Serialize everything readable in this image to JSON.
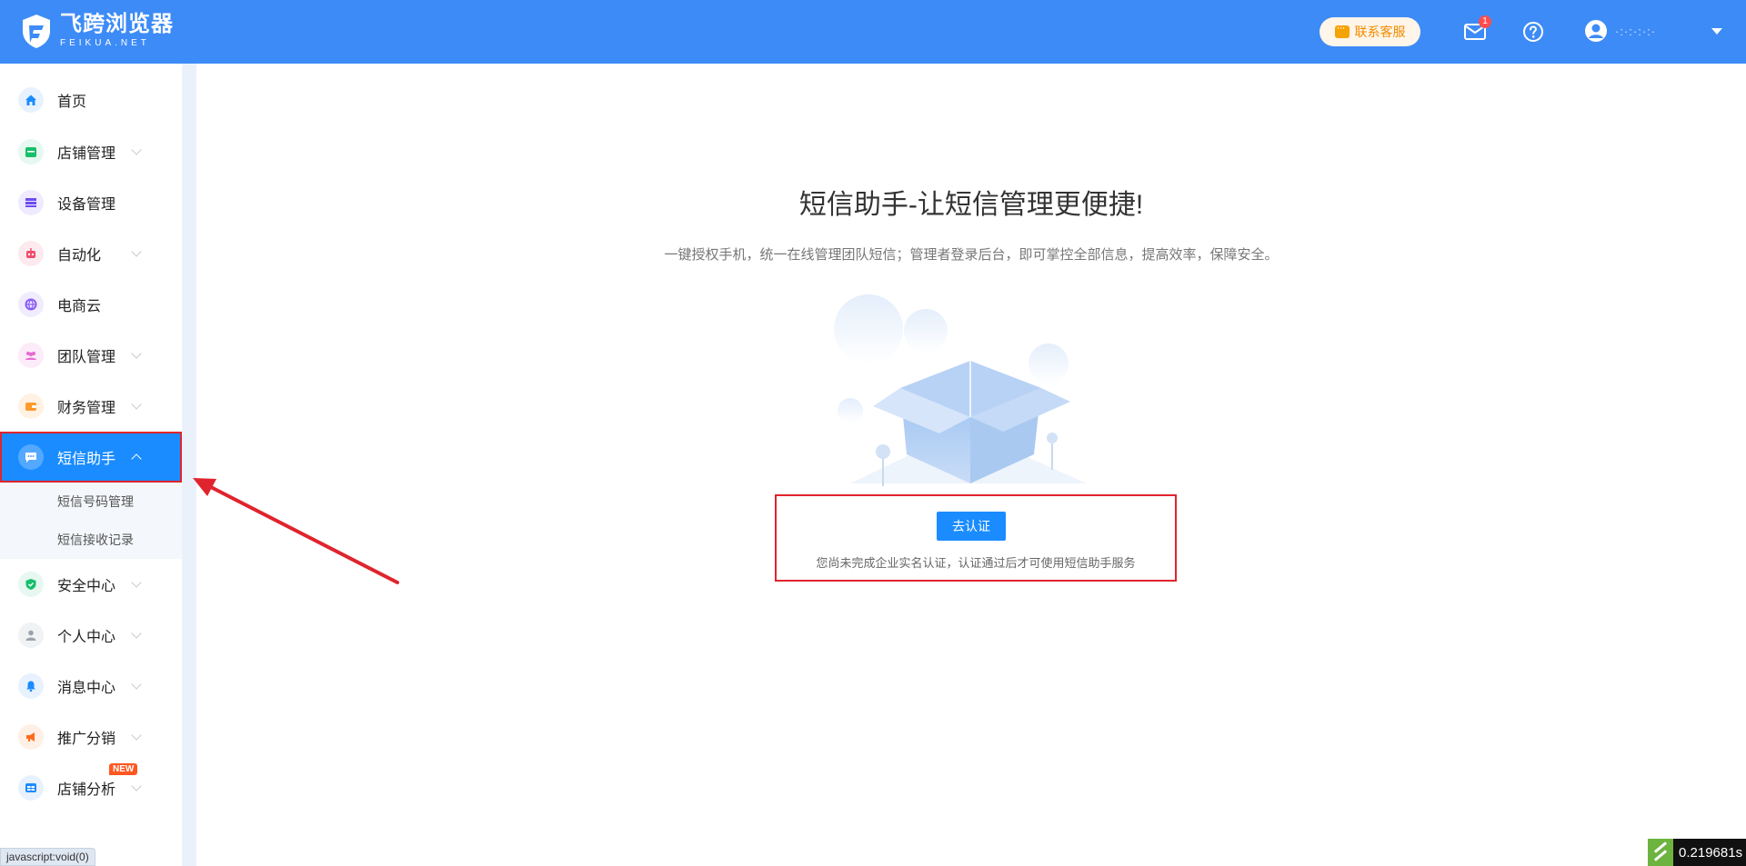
{
  "header": {
    "logo_cn": "飞跨浏览器",
    "logo_en": "FEIKUA.NET",
    "service_label": "联系客服",
    "mail_badge": "1",
    "user_name": "·:·:·:·:·"
  },
  "sidebar": {
    "items": [
      {
        "label": "首页",
        "icon": "home-icon",
        "color": "#1a8cff"
      },
      {
        "label": "店铺管理",
        "icon": "store-icon",
        "color": "#19be6b"
      },
      {
        "label": "设备管理",
        "icon": "device-icon",
        "color": "#6c4cf1"
      },
      {
        "label": "自动化",
        "icon": "robot-icon",
        "color": "#f04b6b"
      },
      {
        "label": "电商云",
        "icon": "cloud-icon",
        "color": "#8a5cf6"
      },
      {
        "label": "团队管理",
        "icon": "team-icon",
        "color": "#e86ad0"
      },
      {
        "label": "财务管理",
        "icon": "wallet-icon",
        "color": "#ff9a2e"
      },
      {
        "label": "短信助手",
        "icon": "message-icon",
        "color": "#ffffff"
      },
      {
        "label": "安全中心",
        "icon": "shield-icon",
        "color": "#19be6b"
      },
      {
        "label": "个人中心",
        "icon": "person-icon",
        "color": "#9aa3ad"
      },
      {
        "label": "消息中心",
        "icon": "bell-icon",
        "color": "#1a8cff"
      },
      {
        "label": "推广分销",
        "icon": "megaphone-icon",
        "color": "#ff6a1a"
      },
      {
        "label": "店铺分析",
        "icon": "analysis-icon",
        "color": "#1a8cff"
      }
    ],
    "sub_items": [
      "短信号码管理",
      "短信接收记录"
    ],
    "new_badge": "NEW"
  },
  "main": {
    "title": "短信助手-让短信管理更便捷!",
    "description": "一键授权手机，统一在线管理团队短信；管理者登录后台，即可掌控全部信息，提高效率，保障安全。",
    "verify_button": "去认证",
    "verify_note": "您尚未完成企业实名认证，认证通过后才可使用短信助手服务"
  },
  "status_bar": "javascript:void(0)",
  "timer": "0.219681s",
  "colors": {
    "header_bg": "#3d8bf7",
    "accent": "#1a8cff",
    "highlight_border": "#e0242d"
  }
}
